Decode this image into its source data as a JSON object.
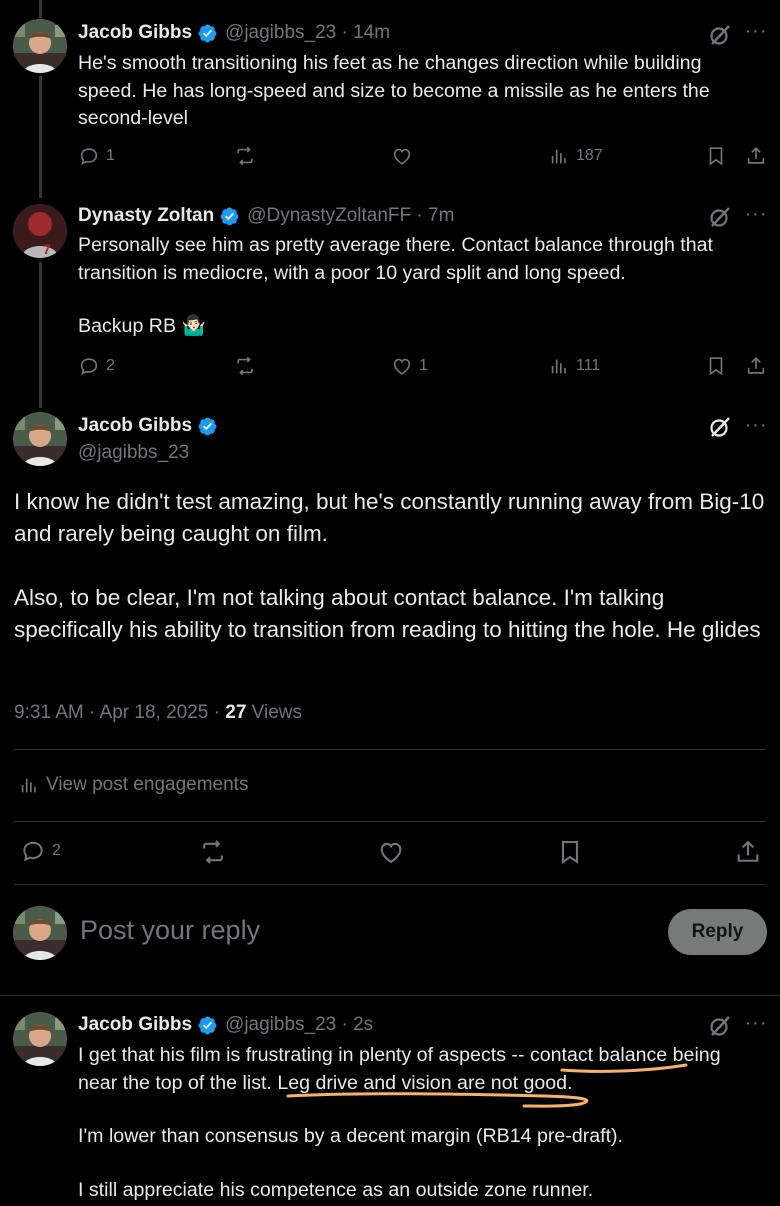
{
  "replies_above": [
    {
      "name": "Jacob Gibbs",
      "handle": "@jagibbs_23 · 14m",
      "text": "He's smooth transitioning his feet as he changes direction while building speed. He has long-speed and size to become a missile as he enters the second-level",
      "replies": "1",
      "reposts": "",
      "likes": "",
      "views": "187"
    },
    {
      "name": "Dynasty Zoltan",
      "handle": "@DynastyZoltanFF · 7m",
      "text_line1": "Personally see him as pretty average there. Contact balance through that transition is mediocre, with a poor 10 yard split and long speed.",
      "text_line2": "Backup RB 🤷🏻‍♂️",
      "replies": "2",
      "reposts": "",
      "likes": "1",
      "views": "111"
    }
  ],
  "main_post": {
    "name": "Jacob Gibbs",
    "handle": "@jagibbs_23",
    "paragraph1": "I know he didn't test amazing, but he's constantly running away from Big-10 and rarely being caught on film.",
    "paragraph2": "Also, to be clear, I'm not talking about contact balance. I'm talking specifically his ability to transition from reading to hitting the hole. He glides",
    "time": "9:31 AM · Apr 18, 2025 · ",
    "views_count": "27",
    "views_label": " Views",
    "engagements_label": "View post engagements",
    "replies": "2"
  },
  "composer": {
    "placeholder": "Post your reply",
    "button_label": "Reply"
  },
  "reply_below": {
    "name": "Jacob Gibbs",
    "handle": "@jagibbs_23 · 2s",
    "p1_part1": "I get that his film is frustrating in plenty of aspects -- ",
    "p1_highlight1": "contact balance",
    "p1_part2": " being near the top of the list. ",
    "p1_highlight2": "Leg drive and vision are not good.",
    "p2": "I'm lower than consensus by a decent margin (RB14 pre-draft).",
    "p3": "I still appreciate his competence as an outside zone runner."
  },
  "colors": {
    "background": "#000000",
    "text": "#e7e9ea",
    "muted": "#71767b",
    "verified": "#1d9bf0",
    "annotation": "#f6b26b",
    "reply_button": "#787a7a"
  }
}
